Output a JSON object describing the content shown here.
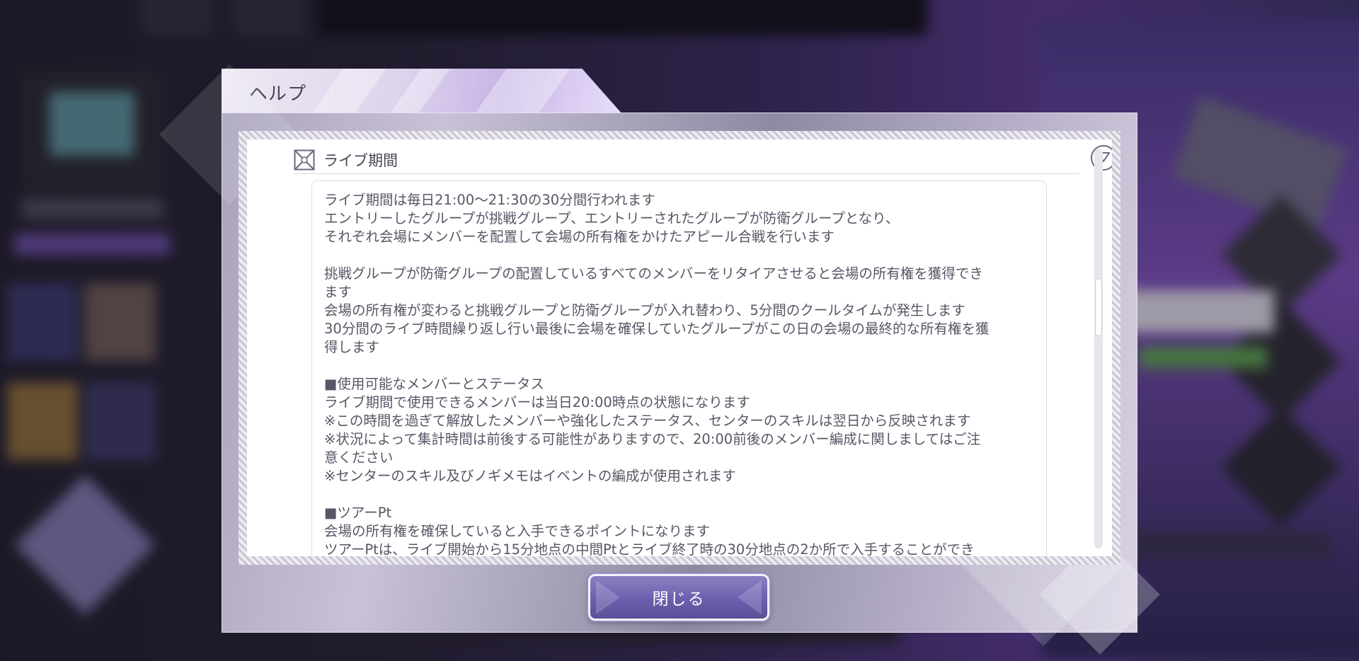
{
  "dialog": {
    "title": "ヘルプ",
    "close_label": "閉じる"
  },
  "section": {
    "title": "ライブ期間"
  },
  "body_lines": [
    "ライブ期間は毎日21:00～21:30の30分間行われます",
    "エントリーしたグループが挑戦グループ、エントリーされたグループが防衛グループとなり、",
    "それぞれ会場にメンバーを配置して会場の所有権をかけたアピール合戦を行います",
    "",
    "挑戦グループが防衛グループの配置しているすべてのメンバーをリタイアさせると会場の所有権を獲得でき",
    "ます",
    "会場の所有権が変わると挑戦グループと防衛グループが入れ替わり、5分間のクールタイムが発生します",
    "30分間のライブ時間繰り返し行い最後に会場を確保していたグループがこの日の会場の最終的な所有権を獲",
    "得します",
    "",
    "■使用可能なメンバーとステータス",
    "ライブ期間で使用できるメンバーは当日20:00時点の状態になります",
    "※この時間を過ぎて解放したメンバーや強化したステータス、センターのスキルは翌日から反映されます",
    "※状況によって集計時間は前後する可能性がありますので、20:00前後のメンバー編成に関しましてはご注",
    "意ください",
    "※センターのスキル及びノギメモはイベントの編成が使用されます",
    "",
    "■ツアーPt",
    "会場の所有権を確保していると入手できるポイントになります",
    "ツアーPtは、ライブ開始から15分地点の中間Ptとライブ終了時の30分地点の2か所で入手することができ"
  ],
  "icons": {
    "section": "crossed-box-icon",
    "collapse": "triangle-down-icon"
  },
  "colors": {
    "accent": "#6c5fae",
    "text": "#5a5566",
    "title": "#4a4458"
  }
}
